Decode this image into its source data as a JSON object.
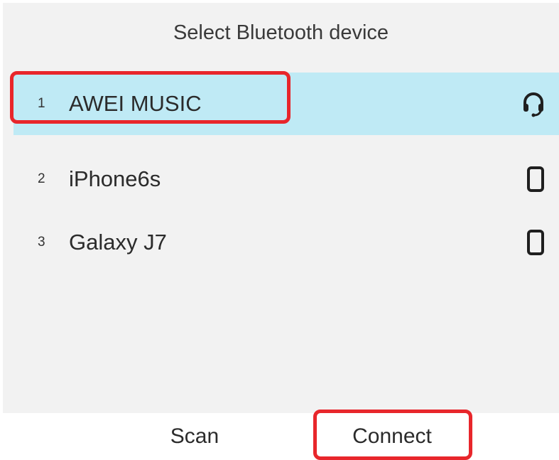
{
  "header": {
    "title": "Select Bluetooth device"
  },
  "devices": [
    {
      "index": "1",
      "name": "AWEI MUSIC",
      "icon": "headset-icon",
      "selected": true
    },
    {
      "index": "2",
      "name": "iPhone6s",
      "icon": "phone-icon",
      "selected": false
    },
    {
      "index": "3",
      "name": "Galaxy J7",
      "icon": "phone-icon",
      "selected": false
    }
  ],
  "softkeys": {
    "scan_label": "Scan",
    "connect_label": "Connect"
  },
  "colors": {
    "selection": "#bfeaf5",
    "highlight_outline": "#e8262b",
    "background": "#f2f2f2"
  }
}
